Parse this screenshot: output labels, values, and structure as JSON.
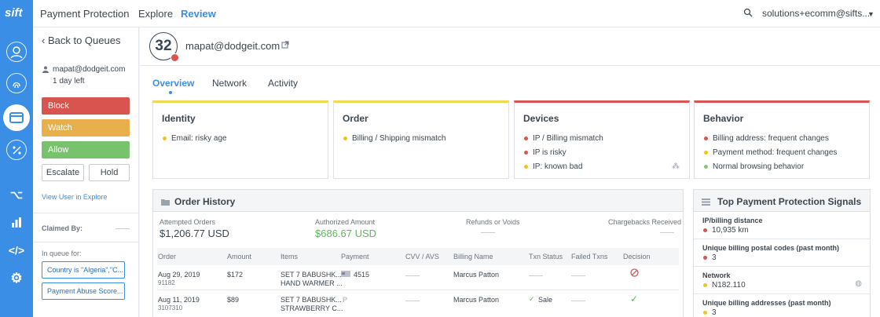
{
  "colors": {
    "accent": "#3a8ee6",
    "block": "#d9534f",
    "watch": "#e7b04d",
    "allow": "#78c26d",
    "positive": "#5cb85c",
    "warning_dot": "#f0c419",
    "info_dot": "#8dc07d"
  },
  "rail": {
    "logo": "sift",
    "icons": [
      "user-icon",
      "fingerprint-icon",
      "payment-card-icon",
      "promo-icon",
      "workflow-icon",
      "analytics-icon",
      "code-icon",
      "settings-icon"
    ]
  },
  "header": {
    "product": "Payment Protection",
    "nav": [
      "Explore",
      "Review"
    ],
    "active_nav": "Review",
    "account": "solutions+ecomm@sifts..."
  },
  "sidebar": {
    "back": "Back to Queues",
    "user_email": "mapat@dodgeit.com",
    "time_left": "1 day left",
    "block": "Block",
    "watch": "Watch",
    "allow": "Allow",
    "escalate": "Escalate",
    "hold": "Hold",
    "view_user": "View User in Explore",
    "claimed_by": "Claimed By:",
    "in_queue_for": "In queue for:",
    "queues": [
      "Country is \"Algeria\",\"C...",
      "Payment Abuse Score..."
    ]
  },
  "user": {
    "score": "32",
    "email": "mapat@dodgeit.com"
  },
  "tabs": [
    "Overview",
    "Network",
    "Activity"
  ],
  "cards": [
    {
      "title": "Identity",
      "items": [
        {
          "text": "Email: risky age",
          "dot": "#f0c419"
        }
      ]
    },
    {
      "title": "Order",
      "items": [
        {
          "text": "Billing / Shipping mismatch",
          "dot": "#f0c419"
        }
      ]
    },
    {
      "title": "Devices",
      "items": [
        {
          "text": "IP / Billing mismatch",
          "dot": "#d9534f"
        },
        {
          "text": "IP is risky",
          "dot": "#d9534f"
        },
        {
          "text": "IP: known bad",
          "dot": "#f0c419"
        }
      ]
    },
    {
      "title": "Behavior",
      "items": [
        {
          "text": "Billing address: frequent changes",
          "dot": "#d9534f"
        },
        {
          "text": "Payment method: frequent changes",
          "dot": "#f0c419"
        },
        {
          "text": "Normal browsing behavior",
          "dot": "#8dc07d"
        }
      ]
    }
  ],
  "order_history": {
    "title": "Order History",
    "stats": [
      {
        "label": "Attempted Orders",
        "value": "$1,206.77 USD"
      },
      {
        "label": "Authorized Amount",
        "value": "$686.67 USD"
      },
      {
        "label": "Refunds or Voids",
        "value": ""
      },
      {
        "label": "Chargebacks Received",
        "value": ""
      }
    ],
    "columns": [
      "Order",
      "Amount",
      "Items",
      "Payment",
      "CVV / AVS",
      "Billing Name",
      "Txn Status",
      "Failed Txns",
      "Decision"
    ],
    "rows": [
      {
        "date": "Aug 29, 2019",
        "id": "91182",
        "amount": "$172",
        "item1": "SET 7 BABUSHK...",
        "item2": "HAND WARMER ...",
        "payment": "4515",
        "billing": "Marcus Patton",
        "status": "",
        "decision": "blocked-icon"
      },
      {
        "date": "Aug 11, 2019",
        "id": "3107310",
        "amount": "$89",
        "item1": "SET 7 BABUSHK...",
        "item2": "STRAWBERRY C...",
        "payment": "",
        "billing": "Marcus Patton",
        "status": "Sale",
        "decision": "check-icon"
      }
    ]
  },
  "signals": {
    "title": "Top Payment Protection Signals",
    "items": [
      {
        "label": "IP/billing distance",
        "value": "10,935 km",
        "dot": "#d9534f"
      },
      {
        "label": "Unique billing postal codes (past month)",
        "value": "3",
        "dot": "#d9534f"
      },
      {
        "label": "Network",
        "value": "N182.110",
        "dot": "#f0c419"
      },
      {
        "label": "Unique billing addresses (past month)",
        "value": "3",
        "dot": "#f0c419"
      }
    ]
  }
}
